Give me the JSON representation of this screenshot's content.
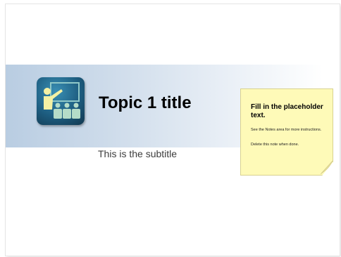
{
  "slide": {
    "title": "Topic 1 title",
    "subtitle": "This is the subtitle",
    "icon": "presenter-at-board-icon"
  },
  "note": {
    "heading": "Fill in the placeholder text.",
    "line1": "See the Notes area for more instructions.",
    "line2": "Delete this note when done."
  },
  "colors": {
    "band_start": "#b9cde2",
    "note_background": "#fefab8",
    "icon_figure": "#f4f1a4",
    "icon_tile": "#1d5d80"
  }
}
